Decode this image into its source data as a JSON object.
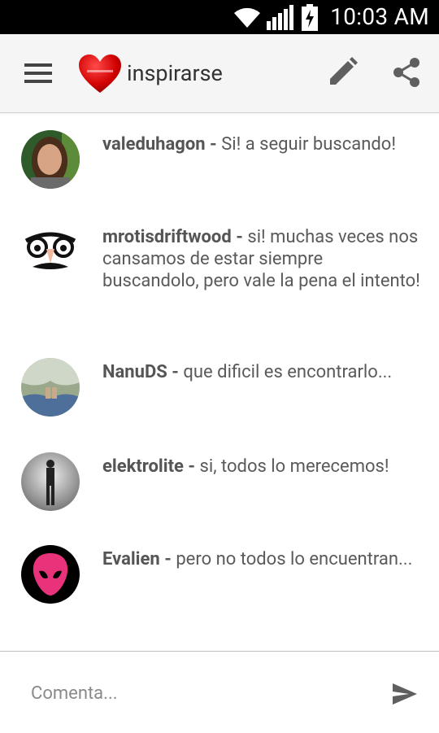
{
  "status_bar": {
    "time": "10:03 AM"
  },
  "toolbar": {
    "title": "inspirarse"
  },
  "comments": [
    {
      "author": "valeduhagon",
      "text": "Si! a seguir buscando!"
    },
    {
      "author": "mrotisdriftwood",
      "text": "si! muchas veces nos cansamos de estar siempre buscandolo, pero vale la pena el intento!"
    },
    {
      "author": "NanuDS",
      "text": "que dificil es encontrarlo..."
    },
    {
      "author": "elektrolite",
      "text": "si, todos lo merecemos!"
    },
    {
      "author": "Evalien",
      "text": "pero no todos lo encuentran..."
    }
  ],
  "composer": {
    "placeholder": "Comenta..."
  },
  "colors": {
    "accent": "#d10000",
    "toolbar_bg": "#f5f5f5",
    "icon": "#5f5f5f"
  },
  "icons": [
    "wifi-icon",
    "signal-icon",
    "battery-icon",
    "menu-icon",
    "heart-logo-icon",
    "edit-icon",
    "share-icon",
    "send-icon"
  ]
}
